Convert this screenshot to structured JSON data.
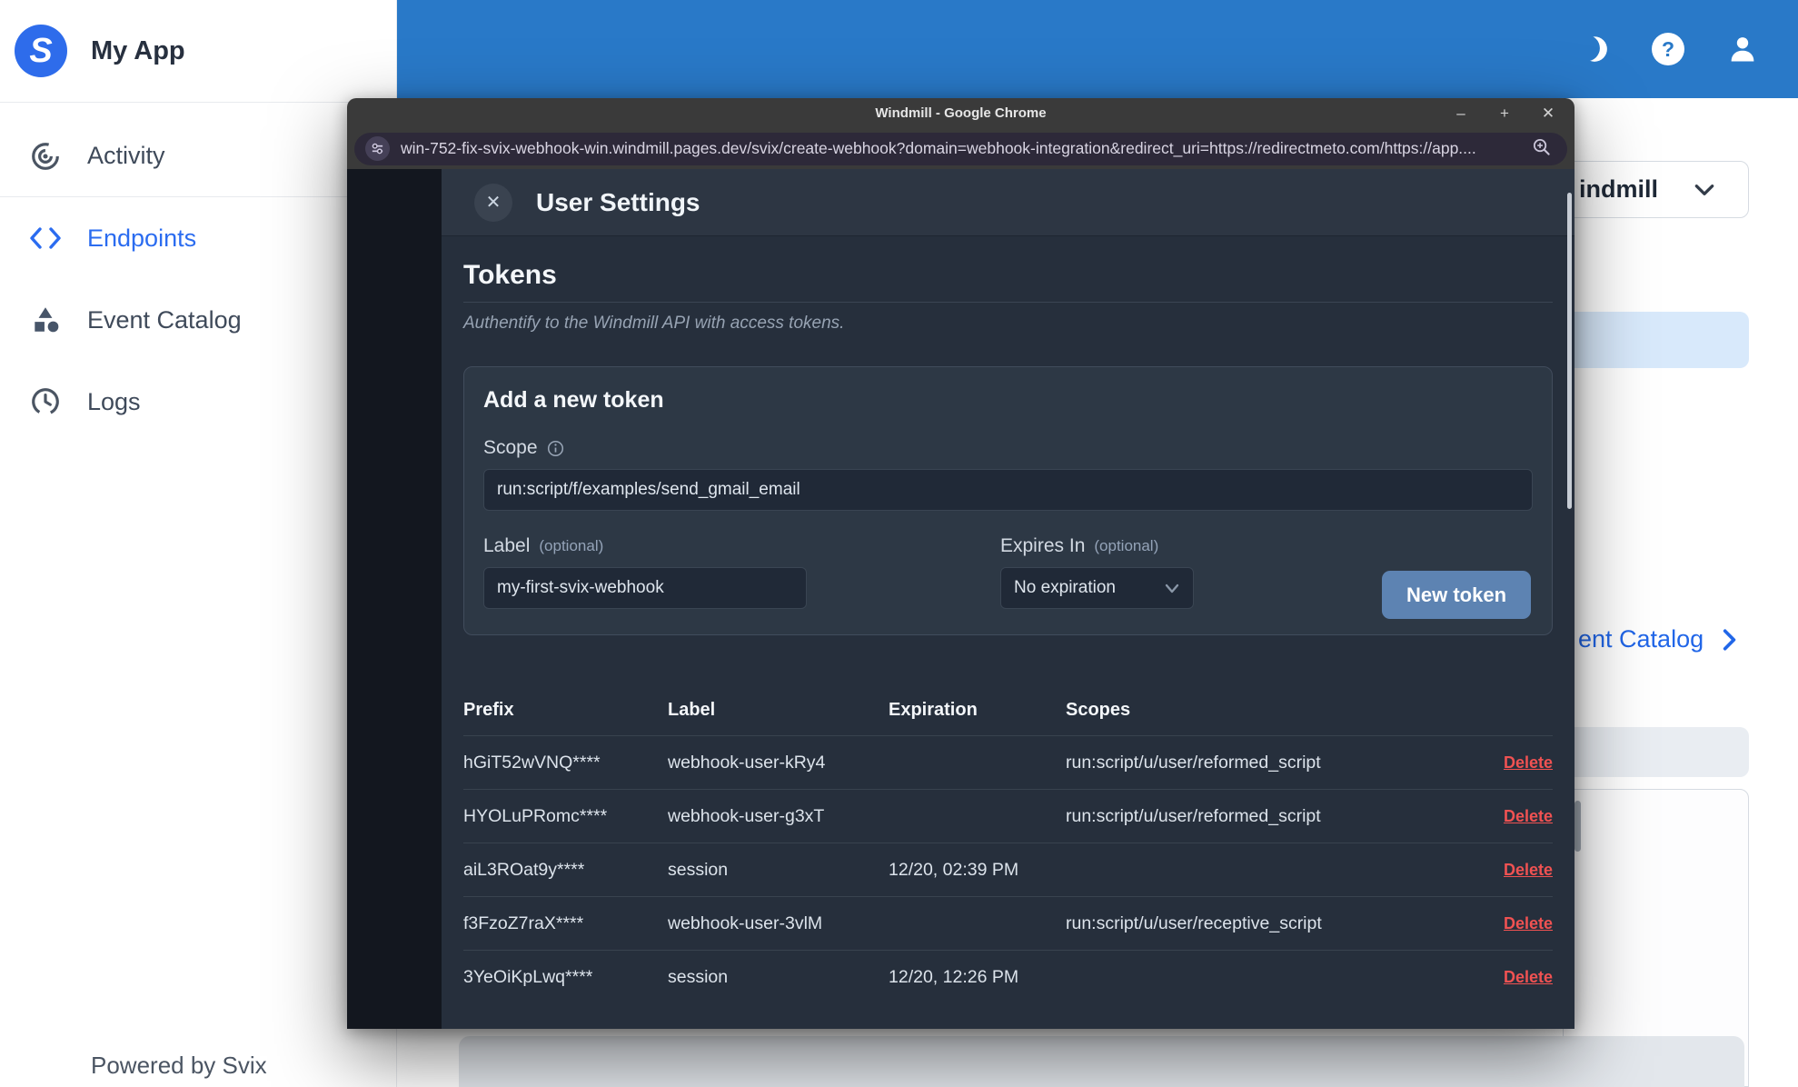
{
  "brand": {
    "app_name": "My App",
    "logo_letter": "S",
    "powered_by": "Powered by Svix"
  },
  "sidebar": {
    "items": [
      {
        "label": "Activity",
        "icon": "activity-icon",
        "active": false
      },
      {
        "label": "Endpoints",
        "icon": "endpoints-icon",
        "active": true
      },
      {
        "label": "Event Catalog",
        "icon": "event-catalog-icon",
        "active": false
      },
      {
        "label": "Logs",
        "icon": "logs-icon",
        "active": false
      }
    ]
  },
  "topbar": {
    "icons": [
      "moon-icon",
      "help-icon",
      "user-icon"
    ]
  },
  "background": {
    "workspace_partial": "indmill",
    "catalog_link_partial": "ent Catalog"
  },
  "chrome": {
    "title": "Windmill - Google Chrome",
    "controls": {
      "minimize": "–",
      "maximize": "+",
      "close": "✕"
    },
    "url": "win-752-fix-svix-webhook-win.windmill.pages.dev/svix/create-webhook?domain=webhook-integration&redirect_uri=https://redirectmeto.com/https://app...."
  },
  "modal": {
    "title": "User Settings",
    "close_glyph": "✕",
    "section_title": "Tokens",
    "section_subtitle": "Authentify to the Windmill API with access tokens.",
    "add_token": {
      "title": "Add a new token",
      "scope_label": "Scope",
      "scope_value": "run:script/f/examples/send_gmail_email",
      "label_label": "Label",
      "optional": "(optional)",
      "label_value": "my-first-svix-webhook",
      "expires_label": "Expires In",
      "expires_value": "No expiration",
      "button_label": "New token"
    },
    "table": {
      "headers": [
        "Prefix",
        "Label",
        "Expiration",
        "Scopes"
      ],
      "delete_label": "Delete",
      "rows": [
        {
          "prefix": "hGiT52wVNQ****",
          "label": "webhook-user-kRy4",
          "expiration": "",
          "scopes": "run:script/u/user/reformed_script"
        },
        {
          "prefix": "HYOLuPRomc****",
          "label": "webhook-user-g3xT",
          "expiration": "",
          "scopes": "run:script/u/user/reformed_script"
        },
        {
          "prefix": "aiL3ROat9y****",
          "label": "session",
          "expiration": "12/20, 02:39 PM",
          "scopes": ""
        },
        {
          "prefix": "f3FzoZ7raX****",
          "label": "webhook-user-3vlM",
          "expiration": "",
          "scopes": "run:script/u/user/receptive_script"
        },
        {
          "prefix": "3YeOiKpLwq****",
          "label": "session",
          "expiration": "12/20, 12:26 PM",
          "scopes": ""
        }
      ]
    }
  },
  "colors": {
    "topbar_blue": "#2979c8",
    "brand_blue": "#2e6ceb",
    "active_nav_blue": "#2b6cf0",
    "link_blue": "#2166e8",
    "button_blue": "#5d83b2",
    "delete_red": "#f05252",
    "modal_bg": "#262f3c"
  }
}
